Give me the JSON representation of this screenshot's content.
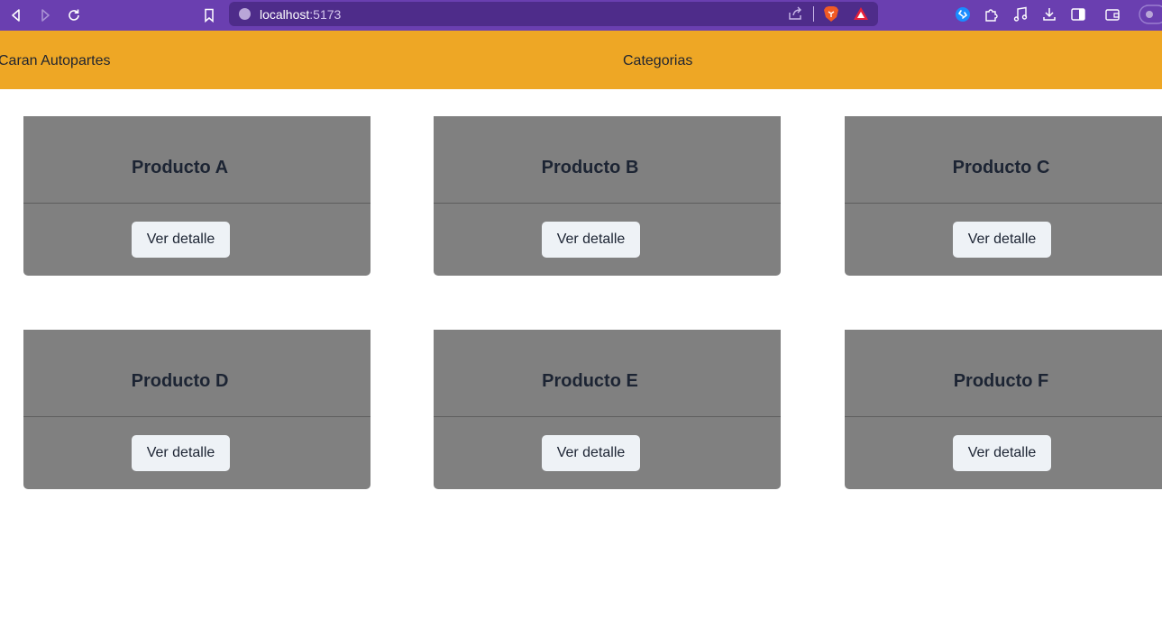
{
  "browser": {
    "url_host": "localhost",
    "url_port": ":5173"
  },
  "navbar": {
    "brand": "Caran Autopartes",
    "link": "Categorias",
    "color": "#eea725"
  },
  "products": [
    {
      "title": "Producto A",
      "button": "Ver detalle"
    },
    {
      "title": "Producto B",
      "button": "Ver detalle"
    },
    {
      "title": "Producto C",
      "button": "Ver detalle"
    },
    {
      "title": "Producto D",
      "button": "Ver detalle"
    },
    {
      "title": "Producto E",
      "button": "Ver detalle"
    },
    {
      "title": "Producto F",
      "button": "Ver detalle"
    }
  ]
}
